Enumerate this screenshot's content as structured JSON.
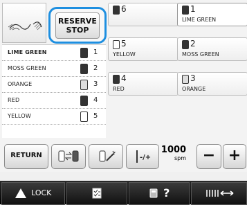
{
  "reserve_stop": {
    "line1": "RESERVE",
    "line2": "STOP"
  },
  "color_list": [
    {
      "name": "LIME GREEN",
      "num": "1",
      "selected": true
    },
    {
      "name": "MOSS GREEN",
      "num": "2",
      "selected": false
    },
    {
      "name": "ORANGE",
      "num": "3",
      "selected": false
    },
    {
      "name": "RED",
      "num": "4",
      "selected": false
    },
    {
      "name": "YELLOW",
      "num": "5",
      "selected": false
    }
  ],
  "needle_grid": [
    {
      "num": "6",
      "name": ""
    },
    {
      "num": "1",
      "name": "LIME GREEN"
    },
    {
      "num": "5",
      "name": "YELLOW"
    },
    {
      "num": "2",
      "name": "MOSS GREEN"
    },
    {
      "num": "4",
      "name": "RED"
    },
    {
      "num": "3",
      "name": "ORANGE"
    }
  ],
  "toolbar": {
    "return_label": "RETURN",
    "speed_value": "1000",
    "speed_unit": "spm",
    "minus": "−",
    "plus": "+"
  },
  "bottom_bar": {
    "lock_label": "LOCK",
    "help_label": "?"
  },
  "colors": {
    "accent": "#1e8fe0"
  }
}
